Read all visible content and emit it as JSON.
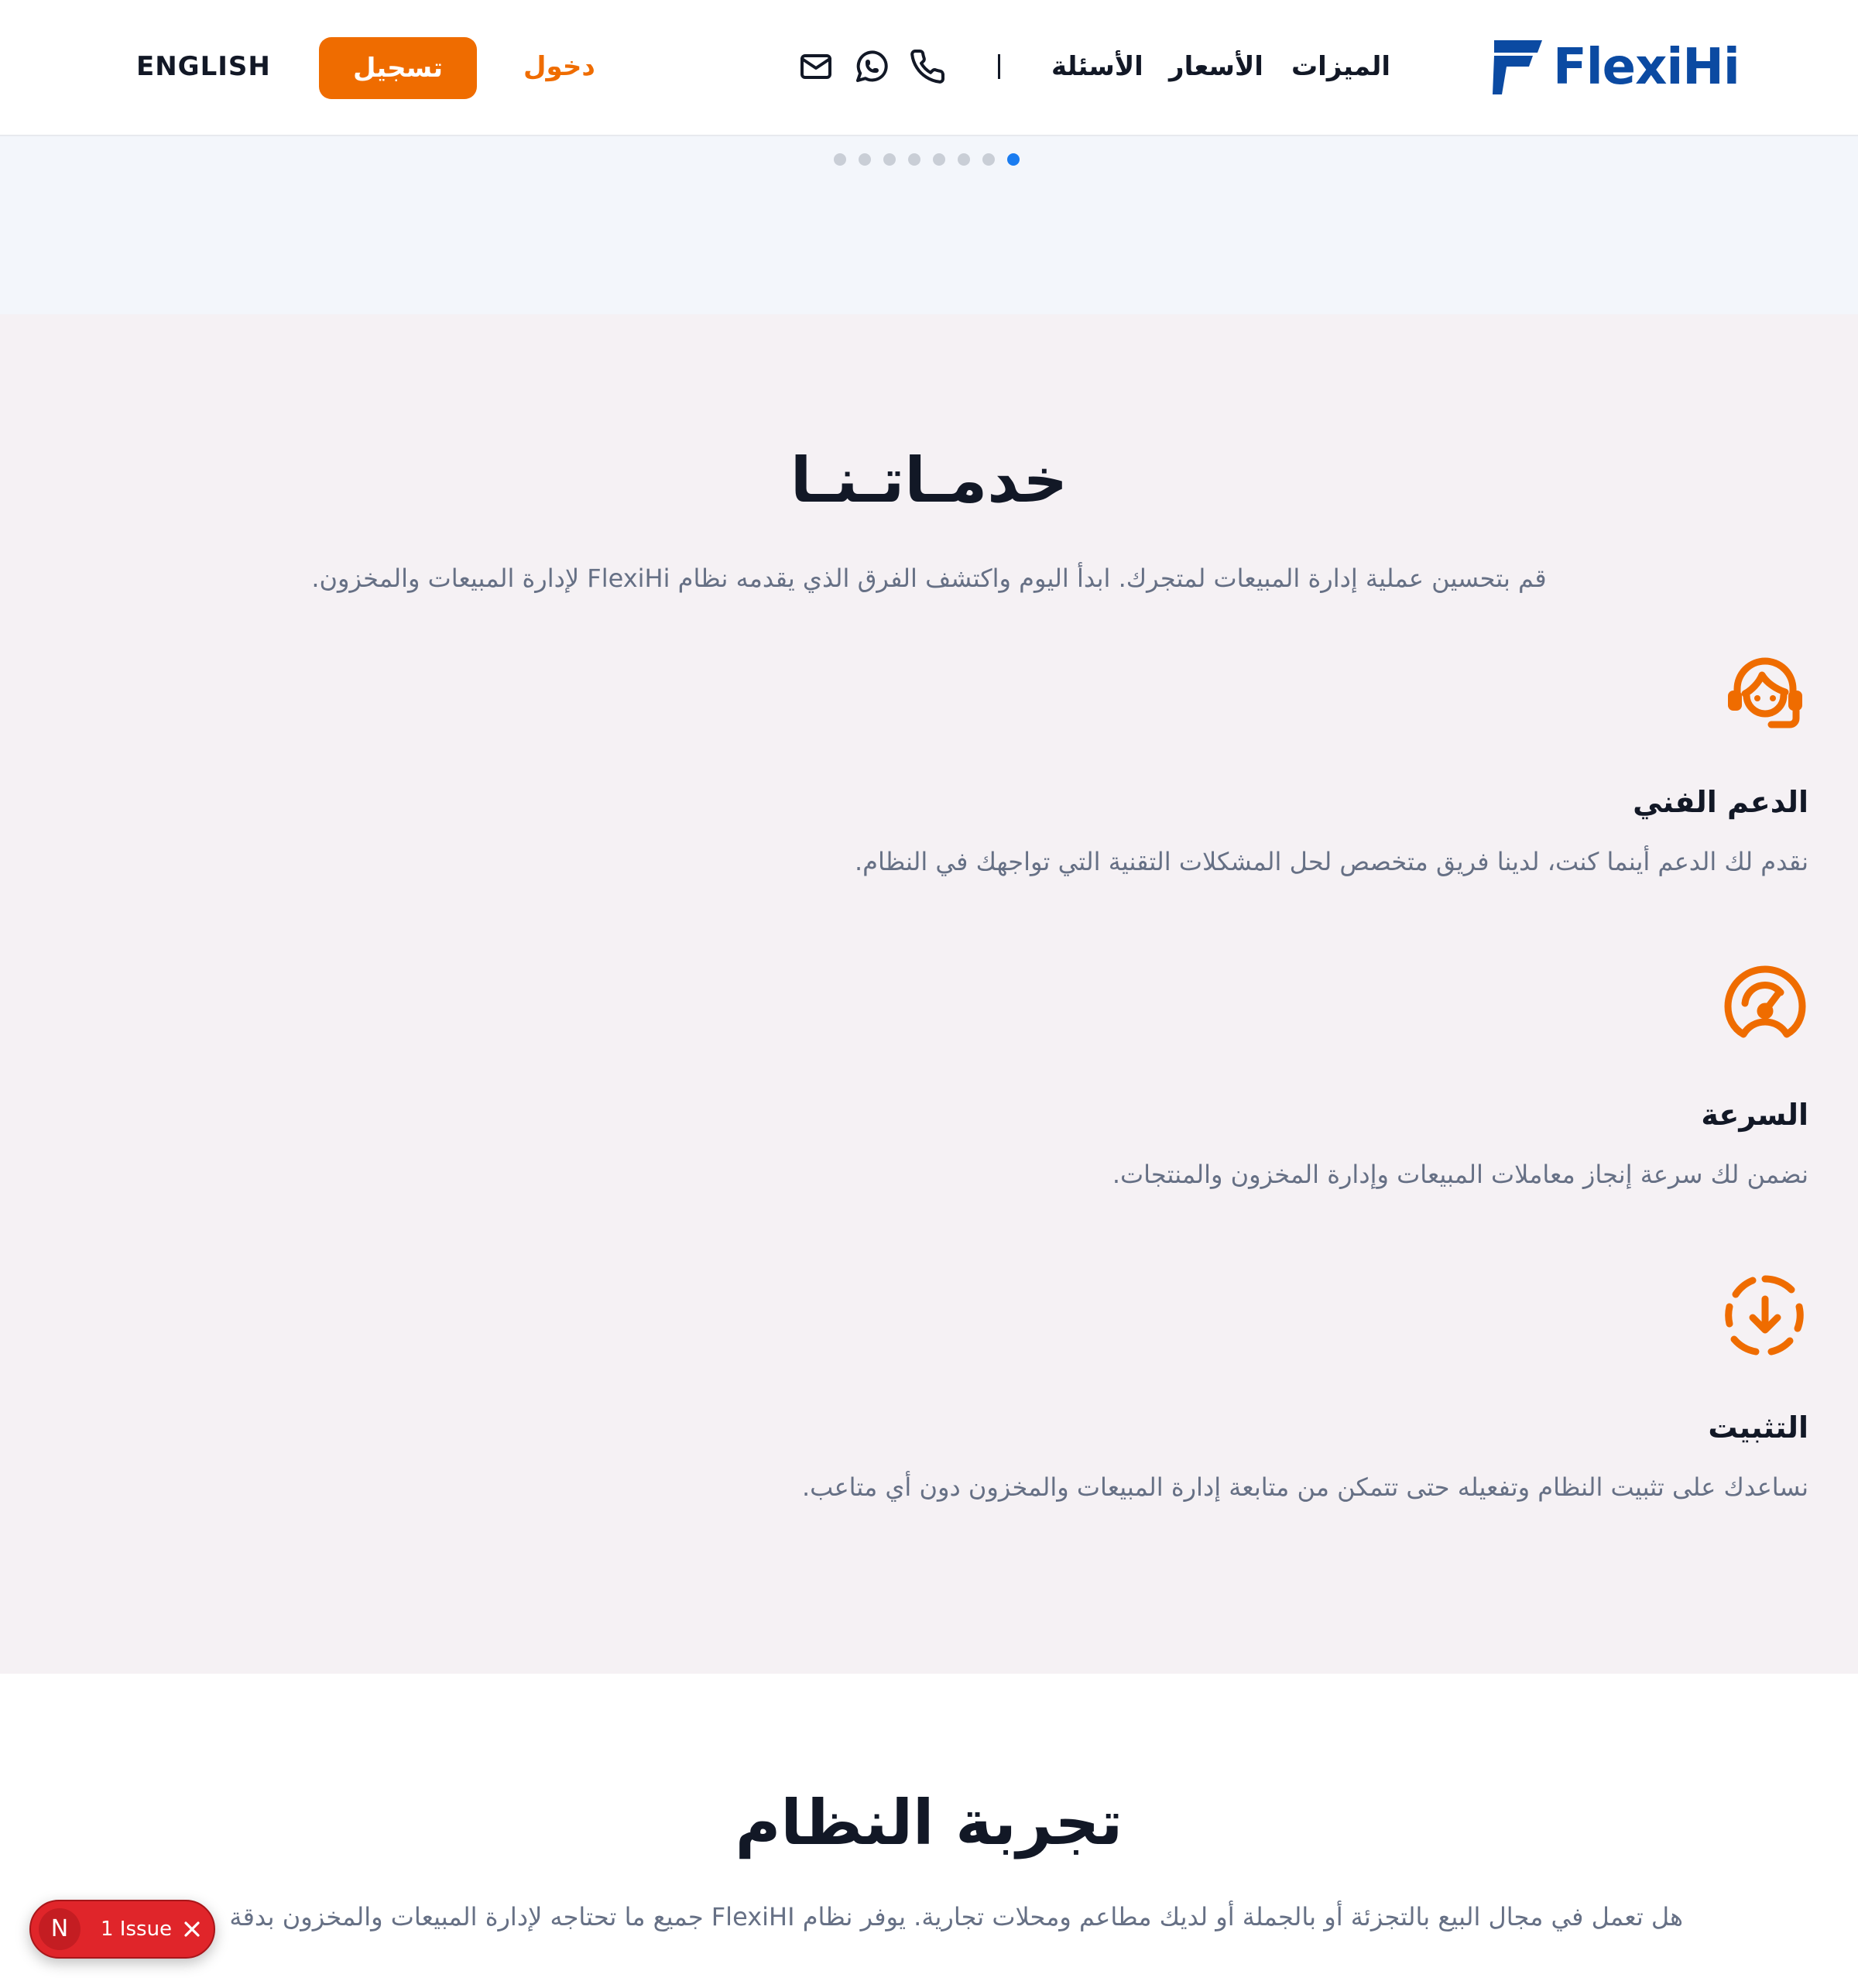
{
  "header": {
    "brand": "FlexiHi",
    "nav": {
      "features": "الميزات",
      "prices": "الأسعار",
      "faq": "الأسئلة"
    },
    "contact_icons": [
      "phone-icon",
      "whatsapp-icon",
      "mail-icon"
    ],
    "login": "دخول",
    "register": "تسجيل",
    "language": "ENGLISH"
  },
  "carousel": {
    "dot_count": 8,
    "active_index": 7
  },
  "services": {
    "title": "خدمـاتـنـا",
    "subtitle": "قم بتحسين عملية إدارة المبيعات لمتجرك. ابدأ اليوم واكتشف الفرق الذي يقدمه نظام FlexiHi لإدارة المبيعات والمخزون.",
    "items": [
      {
        "icon": "headset-support-icon",
        "title": "الدعم الفني",
        "description": "نقدم لك الدعم أينما كنت، لدينا فريق متخصص لحل المشكلات التقنية التي تواجهك في النظام."
      },
      {
        "icon": "speedometer-icon",
        "title": "السرعة",
        "description": "نضمن لك سرعة إنجاز معاملات المبيعات وإدارة المخزون والمنتجات."
      },
      {
        "icon": "install-download-icon",
        "title": "التثبيت",
        "description": "نساعدك على تثبيت النظام وتفعيله حتى تتمكن من متابعة إدارة المبيعات والمخزون دون أي متاعب."
      }
    ]
  },
  "trial": {
    "title": "تجربة النظام",
    "subtitle": "هل تعمل في مجال البيع بالتجزئة أو بالجملة أو لديك مطاعم ومحلات تجارية. يوفر نظام FlexiHI جميع ما تحتاجه لإدارة المبيعات والمخزون بدقة"
  },
  "issue_badge": {
    "letter": "N",
    "label": "1 Issue"
  },
  "colors": {
    "accent": "#ef6c00",
    "brand_blue": "#0b4aa2",
    "active_dot": "#1a7cf0",
    "services_bg": "#f5f1f4",
    "issue_red": "#e0252a"
  }
}
